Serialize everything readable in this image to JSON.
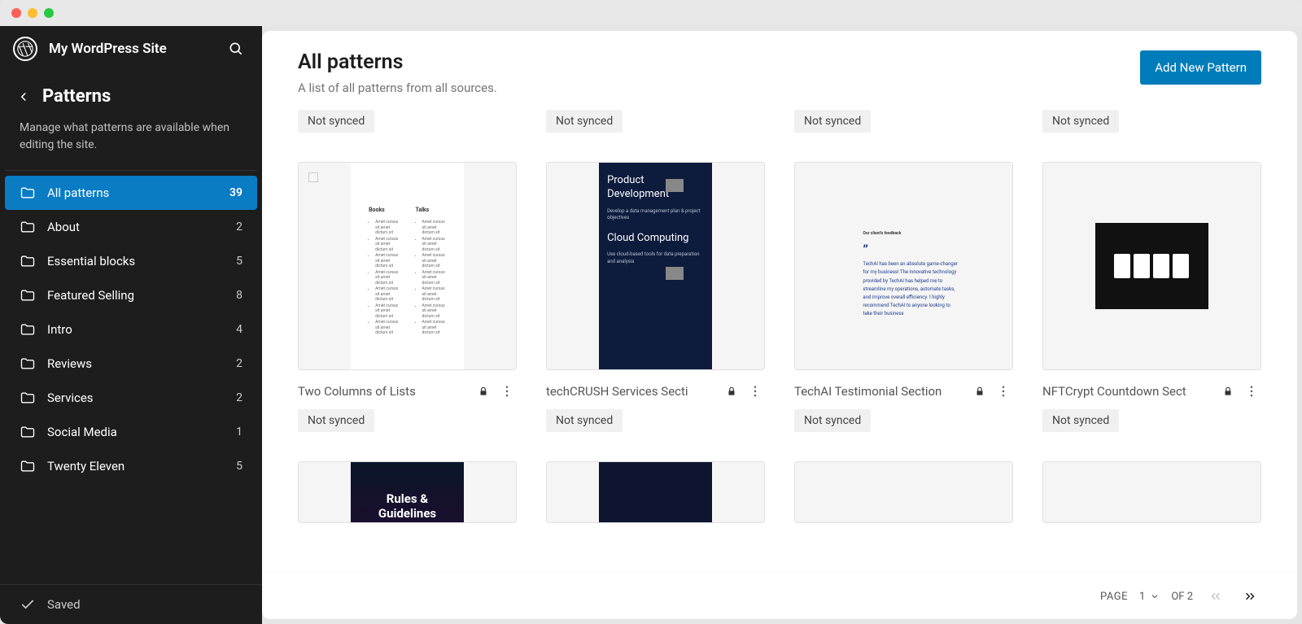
{
  "site_title": "My WordPress Site",
  "nav": {
    "section_title": "Patterns",
    "description": "Manage what patterns are available when editing the site."
  },
  "categories": [
    {
      "label": "All patterns",
      "count": 39,
      "active": true
    },
    {
      "label": "About",
      "count": 2,
      "active": false
    },
    {
      "label": "Essential blocks",
      "count": 5,
      "active": false
    },
    {
      "label": "Featured Selling",
      "count": 8,
      "active": false
    },
    {
      "label": "Intro",
      "count": 4,
      "active": false
    },
    {
      "label": "Reviews",
      "count": 2,
      "active": false
    },
    {
      "label": "Services",
      "count": 2,
      "active": false
    },
    {
      "label": "Social Media",
      "count": 1,
      "active": false
    },
    {
      "label": "Twenty Eleven",
      "count": 5,
      "active": false
    }
  ],
  "saved_label": "Saved",
  "header": {
    "title": "All patterns",
    "subtitle": "A list of all patterns from all sources.",
    "add_button": "Add New Pattern"
  },
  "badges": {
    "not_synced": "Not synced"
  },
  "top_row_badges": [
    "Not synced",
    "Not synced",
    "Not synced",
    "Not synced"
  ],
  "patterns": [
    {
      "title": "Two Columns of Lists",
      "locked": true,
      "sync": "Not synced",
      "thumb": "lists"
    },
    {
      "title": "techCRUSH Services Secti",
      "locked": true,
      "sync": "Not synced",
      "thumb": "dark_services"
    },
    {
      "title": "TechAI Testimonial Section",
      "locked": true,
      "sync": "Not synced",
      "thumb": "testimonial"
    },
    {
      "title": "NFTCrypt Countdown Sect",
      "locked": true,
      "sync": "Not synced",
      "thumb": "countdown"
    }
  ],
  "row3_thumbs": [
    "rules",
    "dark2",
    "blank",
    "blank"
  ],
  "thumb_content": {
    "lists": {
      "col1_title": "Books",
      "col2_title": "Talks"
    },
    "dark_services": {
      "h1": "Product Development",
      "p1": "Develop a data management plan & project objectives",
      "h2": "Cloud Computing",
      "p2": "Use cloud-based tools for data preparation and analysis"
    },
    "testimonial": {
      "label": "Our client's feedback",
      "quote": "TechAI has been an absolute game-changer for my business! The innovative technology provided by TechAI has helped me to streamline my operations, automate tasks, and improve overall efficiency. I highly recommend TechAI to anyone looking to take their business"
    },
    "rules": "Rules & Guidelines"
  },
  "pagination": {
    "page_label": "PAGE",
    "current": 1,
    "of_label": "OF",
    "total": 2
  }
}
